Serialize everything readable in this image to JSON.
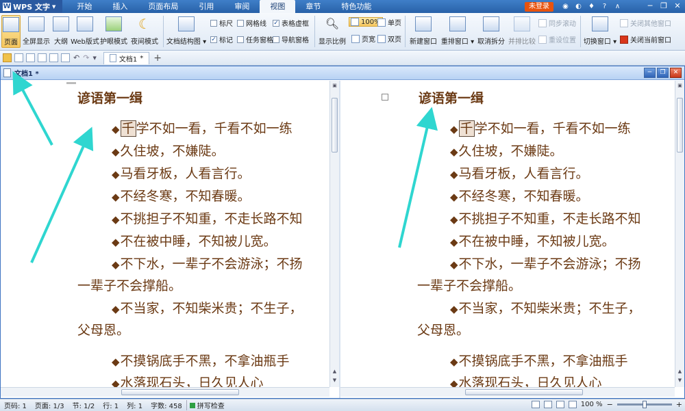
{
  "app": {
    "name": "WPS 文字"
  },
  "menu": [
    {
      "label": "开始",
      "active": false
    },
    {
      "label": "插入",
      "active": false
    },
    {
      "label": "页面布局",
      "active": false
    },
    {
      "label": "引用",
      "active": false
    },
    {
      "label": "审阅",
      "active": false
    },
    {
      "label": "视图",
      "active": true
    },
    {
      "label": "章节",
      "active": false
    },
    {
      "label": "特色功能",
      "active": false
    }
  ],
  "titlebar": {
    "login_label": "未登录"
  },
  "ribbon": {
    "views": [
      "页面",
      "全屏显示",
      "大纲",
      "Web版式",
      "护眼模式",
      "夜间模式"
    ],
    "doc_structure": "文档结构图",
    "checkboxes": {
      "ruler": {
        "label": "标尺",
        "checked": false
      },
      "gridlines": {
        "label": "网格线",
        "checked": false
      },
      "table_frame": {
        "label": "表格虚框",
        "checked": true
      },
      "marks": {
        "label": "标记",
        "checked": true
      },
      "task_pane": {
        "label": "任务窗格",
        "checked": false
      },
      "nav_pane": {
        "label": "导航窗格",
        "checked": false
      }
    },
    "zoom_label": "显示比例",
    "zoom_100": "100%",
    "page_width": "页宽",
    "single_page": "单页",
    "double_page": "双页",
    "new_window": "新建窗口",
    "arrange_window": "重排窗口",
    "cancel_split": "取消拆分",
    "side_by_side": "并排比较",
    "sync_scroll": "同步滚动",
    "reset_position": "重设位置",
    "switch_window": "切换窗口",
    "close_others": "关闭其他窗口",
    "close_current": "关闭当前窗口"
  },
  "tabs": {
    "doc_tab": "文档1",
    "modified_mark": "*"
  },
  "mdi": {
    "title": "文档1",
    "modified_mark": "*"
  },
  "document": {
    "title": "谚语第一缉",
    "lines": [
      {
        "diamond": "◆",
        "cursor_char": "千",
        "text": "学不如一看，千看不如一练"
      },
      {
        "diamond": "◆",
        "text": "久住坡，不嫌陡。"
      },
      {
        "diamond": "◆",
        "text": "马看牙板，人看言行。"
      },
      {
        "diamond": "◆",
        "text": "不经冬寒，不知春暖。"
      },
      {
        "diamond": "◆",
        "text": "不挑担子不知重，不走长路不知"
      },
      {
        "diamond": "◆",
        "text": "不在被中睡，不知被儿宽。"
      },
      {
        "diamond": "◆",
        "text": "不下水，一辈子不会游泳；不扬"
      },
      {
        "diamond": "",
        "text": "一辈子不会撑船。"
      },
      {
        "diamond": "◆",
        "text": "不当家，不知柴米贵；不生子，"
      },
      {
        "diamond": "",
        "text": "父母恩。"
      },
      {
        "diamond": "◆",
        "text": "不摸锅底手不黑，不拿油瓶手"
      },
      {
        "diamond": "◆",
        "text": "水落现石头，日久见人心"
      }
    ]
  },
  "statusbar": {
    "page_code": "页码: 1",
    "page": "页面: 1/3",
    "section": "节: 1/2",
    "row": "行: 1",
    "col": "列: 1",
    "words": "字数: 458",
    "spell": "拼写检查",
    "zoom": "100 %",
    "zoom_level": 0.5
  },
  "colors": {
    "accent": "#2861a8",
    "doc_text": "#6b3a14",
    "arrow": "#2fd6d0"
  }
}
